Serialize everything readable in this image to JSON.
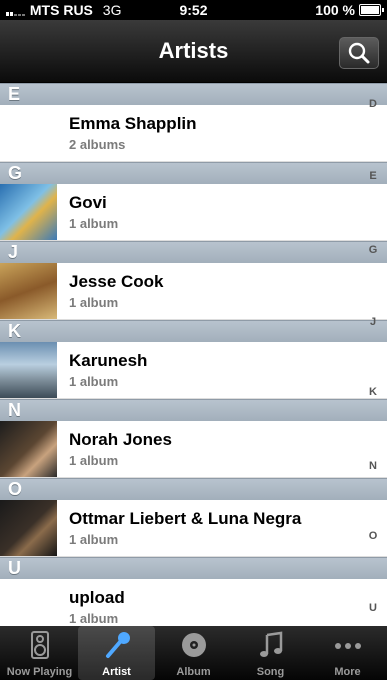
{
  "status": {
    "carrier": "MTS RUS",
    "network": "3G",
    "time": "9:52",
    "battery": "100 %",
    "battery_level": 1.0
  },
  "nav": {
    "title": "Artists"
  },
  "sections": [
    {
      "letter": "E",
      "artists": [
        {
          "name": "Emma Shapplin",
          "count": "2 albums"
        }
      ]
    },
    {
      "letter": "G",
      "artists": [
        {
          "name": "Govi",
          "count": "1 album"
        }
      ]
    },
    {
      "letter": "J",
      "artists": [
        {
          "name": "Jesse Cook",
          "count": "1 album"
        }
      ]
    },
    {
      "letter": "K",
      "artists": [
        {
          "name": "Karunesh",
          "count": "1 album"
        }
      ]
    },
    {
      "letter": "N",
      "artists": [
        {
          "name": "Norah Jones",
          "count": "1 album"
        }
      ]
    },
    {
      "letter": "O",
      "artists": [
        {
          "name": "Ottmar Liebert & Luna Negra",
          "count": "1 album"
        }
      ]
    },
    {
      "letter": "U",
      "artists": [
        {
          "name": "upload",
          "count": "1 album"
        }
      ]
    }
  ],
  "index_letters": [
    "D",
    "E",
    "G",
    "J",
    "K",
    "N",
    "O",
    "U"
  ],
  "tabs": [
    {
      "label": "Now Playing",
      "icon": "speaker-icon"
    },
    {
      "label": "Artist",
      "icon": "microphone-icon"
    },
    {
      "label": "Album",
      "icon": "disc-icon"
    },
    {
      "label": "Song",
      "icon": "music-note-icon"
    },
    {
      "label": "More",
      "icon": "more-dots-icon"
    }
  ],
  "active_tab": 1
}
